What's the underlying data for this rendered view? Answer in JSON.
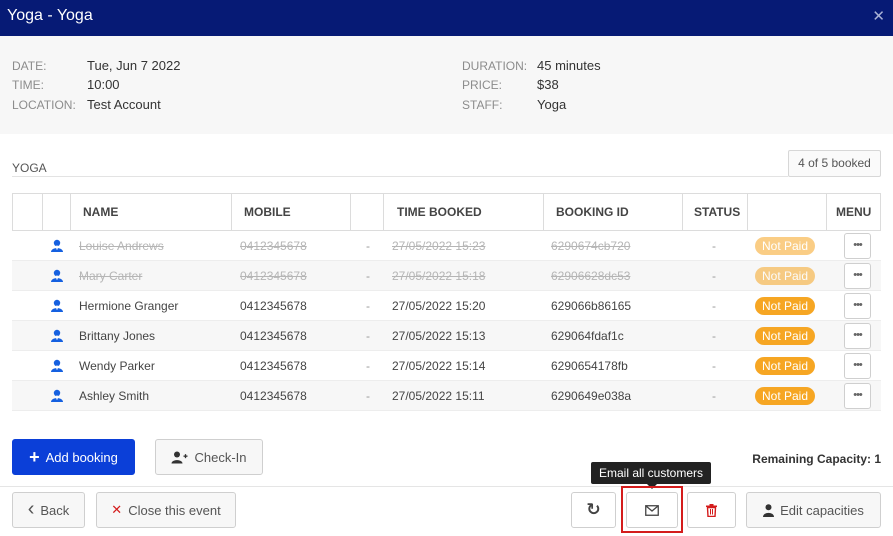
{
  "window": {
    "title": "Yoga - Yoga",
    "close_glyph": "✕"
  },
  "details": {
    "date_label": "DATE:",
    "date": "Tue, Jun 7 2022",
    "time_label": "TIME:",
    "time": "10:00",
    "location_label": "LOCATION:",
    "location": "Test Account",
    "duration_label": "DURATION:",
    "duration": "45 minutes",
    "price_label": "PRICE:",
    "price": "$38",
    "staff_label": "STAFF:",
    "staff": "Yoga"
  },
  "section": {
    "label": "YOGA",
    "booked": "4 of 5 booked"
  },
  "table": {
    "headers": [
      "NAME",
      "MOBILE",
      "TIME BOOKED",
      "BOOKING ID",
      "STATUS",
      "MENU"
    ],
    "rows": [
      {
        "name": "Louise Andrews",
        "mobile": "0412345678",
        "dash": "-",
        "time_booked": "27/05/2022 15:23",
        "booking_id": "6290674cb720",
        "status": "-",
        "payment": "Not Paid",
        "menu": "•••",
        "cancelled": true
      },
      {
        "name": "Mary Carter",
        "mobile": "0412345678",
        "dash": "-",
        "time_booked": "27/05/2022 15:18",
        "booking_id": "62906628dc53",
        "status": "-",
        "payment": "Not Paid",
        "menu": "•••",
        "cancelled": true
      },
      {
        "name": "Hermione Granger",
        "mobile": "0412345678",
        "dash": "-",
        "time_booked": "27/05/2022 15:20",
        "booking_id": "629066b86165",
        "status": "-",
        "payment": "Not Paid",
        "menu": "•••",
        "cancelled": false
      },
      {
        "name": "Brittany Jones",
        "mobile": "0412345678",
        "dash": "-",
        "time_booked": "27/05/2022 15:13",
        "booking_id": "629064fdaf1c",
        "status": "-",
        "payment": "Not Paid",
        "menu": "•••",
        "cancelled": false
      },
      {
        "name": "Wendy Parker",
        "mobile": "0412345678",
        "dash": "-",
        "time_booked": "27/05/2022 15:14",
        "booking_id": "6290654178fb",
        "status": "-",
        "payment": "Not Paid",
        "menu": "•••",
        "cancelled": false
      },
      {
        "name": "Ashley Smith",
        "mobile": "0412345678",
        "dash": "-",
        "time_booked": "27/05/2022 15:11",
        "booking_id": "6290649e038a",
        "status": "-",
        "payment": "Not Paid",
        "menu": "•••",
        "cancelled": false
      }
    ]
  },
  "actions": {
    "add_booking": "Add booking",
    "add_glyph": "+",
    "check_in": "Check-In",
    "remaining_capacity": "Remaining Capacity: 1"
  },
  "footer": {
    "back": "Back",
    "back_glyph": "‹",
    "close_event": "Close this event",
    "close_glyph": "✕",
    "refresh_glyph": "↻",
    "email_tooltip": "Email all customers",
    "edit_capacities": "Edit capacities"
  },
  "colors": {
    "header_bg": "#061a75",
    "primary": "#0b3fd8",
    "not_paid": "#f6a623",
    "danger": "#d41c1c",
    "user_icon": "#1560e0"
  },
  "icons": [
    "user-icon",
    "add-user-icon",
    "refresh-icon",
    "email-icon",
    "trash-icon",
    "person-icon"
  ]
}
